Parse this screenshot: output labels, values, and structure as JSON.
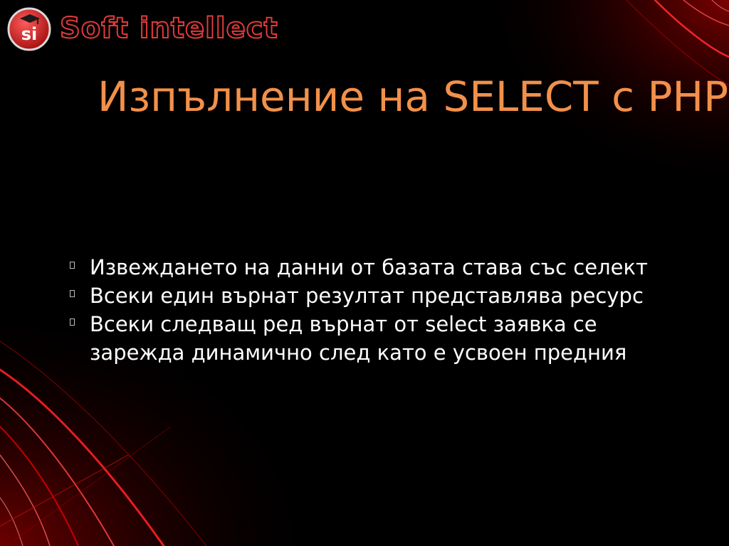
{
  "logo": {
    "monogram": "si",
    "brand": "Soft intellect"
  },
  "slide": {
    "title": "Изпълнение на SELECT с PHP",
    "bullets": [
      "Извеждането на данни от базата става със селект",
      "Всеки един върнат резултат представлява ресурс",
      "Всеки следващ ред върнат от select заявка се зарежда динамично след като е усвоен предния"
    ]
  },
  "colors": {
    "background": "#000000",
    "title": "#f2904a",
    "body_text": "#ffffff",
    "accent": "#e23a3a"
  }
}
